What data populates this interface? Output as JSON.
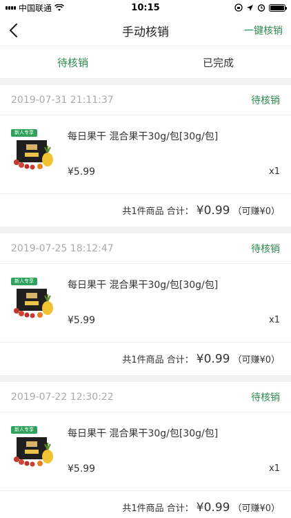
{
  "status_bar": {
    "carrier": "中国联通",
    "time": "10:15"
  },
  "nav": {
    "title": "手动核销",
    "action": "一键核销"
  },
  "tabs": [
    {
      "label": "待核销",
      "active": true
    },
    {
      "label": "已完成",
      "active": false
    }
  ],
  "colors": {
    "accent": "#2d8a4e",
    "badge": "#2fa35d"
  },
  "orders": [
    {
      "date": "2019-07-31 21:11:37",
      "status": "待核销",
      "badge": "新人专享",
      "name": "每日果干 混合果干30g/包[30g/包]",
      "price": "¥5.99",
      "qty": "x1",
      "summary": "共1件商品 合计：",
      "total": "¥0.99",
      "earn": "（可赚¥0）"
    },
    {
      "date": "2019-07-25 18:12:47",
      "status": "待核销",
      "badge": "新人专享",
      "name": "每日果干 混合果干30g/包[30g/包]",
      "price": "¥5.99",
      "qty": "x1",
      "summary": "共1件商品 合计：",
      "total": "¥0.99",
      "earn": "（可赚¥0）"
    },
    {
      "date": "2019-07-22 12:30:22",
      "status": "待核销",
      "badge": "新人专享",
      "name": "每日果干 混合果干30g/包[30g/包]",
      "price": "¥5.99",
      "qty": "x1",
      "summary": "共1件商品 合计：",
      "total": "¥0.99",
      "earn": "（可赚¥0）"
    }
  ]
}
